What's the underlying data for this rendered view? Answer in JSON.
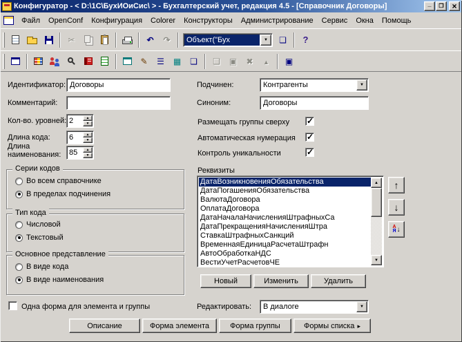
{
  "window": {
    "title": "Конфигуратор - < D:\\1С\\БухИОиСис\\ > - Бухгалтерский учет, редакция 4.5 - [Справочник Договоры]"
  },
  "menu": [
    "Файл",
    "OpenConf",
    "Конфигурация",
    "Colorer",
    "Конструкторы",
    "Администрирование",
    "Сервис",
    "Окна",
    "Помощь"
  ],
  "toolbar1": {
    "combo_value": "Объект(\"Бух"
  },
  "form": {
    "fields": {
      "identifier": {
        "label": "Идентификатор:",
        "value": "Договоры"
      },
      "comment": {
        "label": "Комментарий:",
        "value": ""
      },
      "levels": {
        "label": "Кол-во. уровней:",
        "value": "2"
      },
      "code_length": {
        "label": "Длина кода:",
        "value": "6"
      },
      "name_length": {
        "label": "Длина наименования:",
        "value": "85"
      },
      "parent": {
        "label": "Подчинен:",
        "value": "Контрагенты"
      },
      "synonym": {
        "label": "Синоним:",
        "value": "Договоры"
      }
    },
    "checkboxes": {
      "groups_on_top": {
        "label": "Размещать группы сверху",
        "checked": true
      },
      "auto_numbering": {
        "label": "Автоматическая нумерация",
        "checked": true
      },
      "uniqueness": {
        "label": "Контроль уникальности",
        "checked": true
      },
      "single_form": {
        "label": "Одна форма для элемента и группы",
        "checked": false
      }
    },
    "code_series": {
      "title": "Серии кодов",
      "options": [
        {
          "label": "Во всем справочнике",
          "selected": false
        },
        {
          "label": "В пределах подчинения",
          "selected": true
        }
      ]
    },
    "code_type": {
      "title": "Тип кода",
      "options": [
        {
          "label": "Числовой",
          "selected": false
        },
        {
          "label": "Текстовый",
          "selected": true
        }
      ]
    },
    "main_view": {
      "title": "Основное представление",
      "options": [
        {
          "label": "В виде кода",
          "selected": false
        },
        {
          "label": "В виде наименования",
          "selected": true
        }
      ]
    },
    "attributes": {
      "title": "Реквизиты",
      "items": [
        "ДатаВозникновенияОбязательства",
        "ДатаПогашенияОбязательства",
        "ВалютаДоговора",
        "ОплатаДоговора",
        "ДатаНачалаНачисленияШтрафныхСа",
        "ДатаПрекращенияНачисленияШтра",
        "СтавкаШтрафныхСанкций",
        "ВременнаяЕдиницаРасчетаШтрафн",
        "АвтоОбработкаНДС",
        "ВестиУчетРасчетовЧЕ"
      ],
      "selected_index": 0,
      "buttons": {
        "new": "Новый",
        "edit": "Изменить",
        "delete": "Удалить"
      }
    },
    "edit_mode": {
      "label": "Редактировать:",
      "value": "В диалоге"
    }
  },
  "bottom_buttons": {
    "description": "Описание",
    "element_form": "Форма элемента",
    "group_form": "Форма группы",
    "list_forms": "Формы списка"
  },
  "colors": {
    "titlebar_start": "#0a246a",
    "titlebar_end": "#a6caf0",
    "selection": "#0a246a",
    "face": "#d6d3ce"
  }
}
